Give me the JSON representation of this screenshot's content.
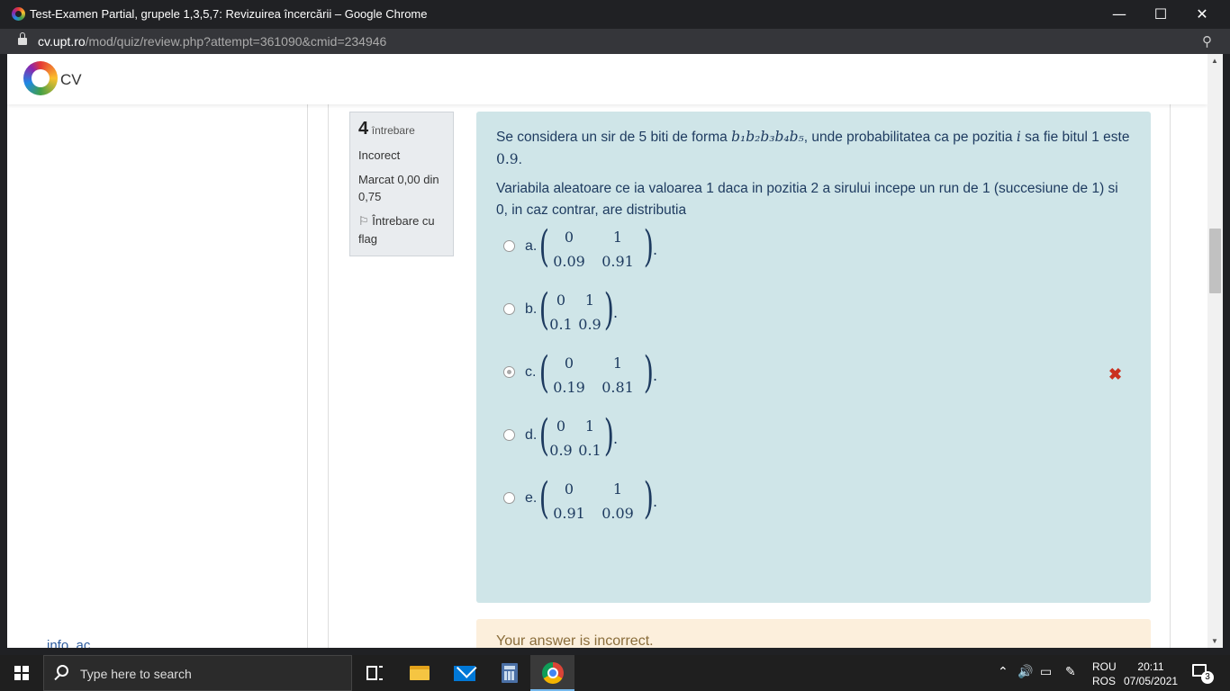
{
  "window": {
    "title": "Test-Examen Partial, grupele 1,3,5,7: Revizuirea încercării – Google Chrome",
    "minimize_icon": "minimize-icon",
    "maximize_icon": "maximize-icon",
    "close_icon": "close-icon"
  },
  "address": {
    "host": "cv.upt.ro",
    "path": "/mod/quiz/review.php?attempt=361090&cmid=234946"
  },
  "site": {
    "name": "CV",
    "left_link": "info_ac"
  },
  "question_info": {
    "number": "4",
    "word": "întrebare",
    "state": "Incorect",
    "grade": "Marcat 0,00 din 0,75",
    "flag": "Întrebare cu flag"
  },
  "question": {
    "p1_a": "Se considera un sir de 5 biti de forma ",
    "p1_math": "b₁b₂b₃b₄b₅",
    "p1_b": ", unde probabilitatea ca pe pozitia ",
    "p1_i": "i",
    "p1_c": " sa fie bitul 1 este ",
    "p1_val": "0.9",
    "p1_end": ".",
    "p2": "Variabila aleatoare ce ia valoarea 1 daca in pozitia 2 a sirului incepe un run de 1 (succesiune de 1) si 0, in caz contrar, are distributia"
  },
  "options": [
    {
      "letter": "a.",
      "top0": "0",
      "top1": "1",
      "bot0": "0.09",
      "bot1": "0.91",
      "checked": false
    },
    {
      "letter": "b.",
      "top0": "0",
      "top1": "1",
      "bot0": "0.1",
      "bot1": "0.9",
      "checked": false
    },
    {
      "letter": "c.",
      "top0": "0",
      "top1": "1",
      "bot0": "0.19",
      "bot1": "0.81",
      "checked": true
    },
    {
      "letter": "d.",
      "top0": "0",
      "top1": "1",
      "bot0": "0.9",
      "bot1": "0.1",
      "checked": false
    },
    {
      "letter": "e.",
      "top0": "0",
      "top1": "1",
      "bot0": "0.91",
      "bot1": "0.09",
      "checked": false
    }
  ],
  "feedback": "Your answer is incorrect.",
  "taskbar": {
    "search_placeholder": "Type here to search",
    "lang_top": "ROU",
    "lang_bottom": "ROS",
    "time": "20:11",
    "date": "07/05/2021",
    "notifications": "3"
  },
  "colors": {
    "question_bg": "#cfe5e8",
    "feedback_bg": "#fcefdc",
    "incorrect": "#ca3120"
  }
}
